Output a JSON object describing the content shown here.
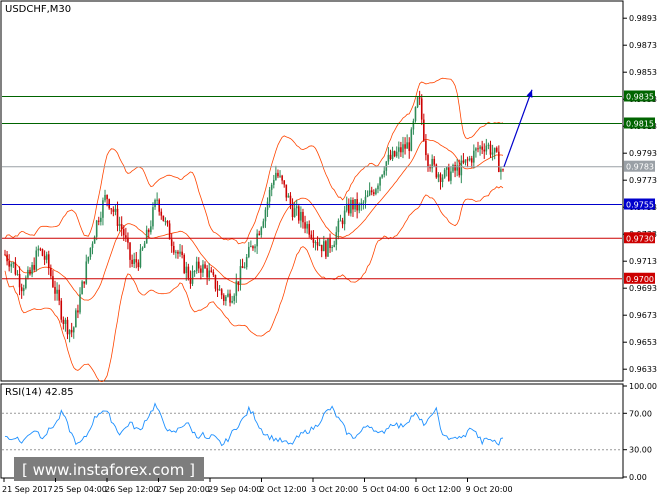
{
  "chart_data": [
    {
      "type": "candlestick",
      "title": "USDCHF,M30",
      "y_ticks": [
        "0.9893",
        "0.9873",
        "0.9853",
        "0.9833",
        "0.9813",
        "0.9793",
        "0.9773",
        "0.9753",
        "0.9733",
        "0.9713",
        "0.9693",
        "0.9673",
        "0.9653",
        "0.9633"
      ],
      "ylim": [
        0.9625,
        0.9905
      ],
      "x_ticks": [
        "21 Sep 2017",
        "25 Sep 04:00",
        "26 Sep 12:00",
        "27 Sep 20:00",
        "29 Sep 04:00",
        "2 Oct 12:00",
        "3 Oct 20:00",
        "5 Oct 04:00",
        "6 Oct 12:00",
        "9 Oct 20:00"
      ],
      "current_price": "0.9783",
      "price_path": [
        [
          0,
          0.9718
        ],
        [
          2,
          0.971
        ],
        [
          4,
          0.9695
        ],
        [
          6,
          0.9703
        ],
        [
          8,
          0.9722
        ],
        [
          10,
          0.9712
        ],
        [
          12,
          0.969
        ],
        [
          14,
          0.9668
        ],
        [
          16,
          0.966
        ],
        [
          18,
          0.969
        ],
        [
          20,
          0.972
        ],
        [
          22,
          0.9745
        ],
        [
          24,
          0.9762
        ],
        [
          26,
          0.9748
        ],
        [
          28,
          0.9735
        ],
        [
          30,
          0.971
        ],
        [
          32,
          0.9715
        ],
        [
          34,
          0.9735
        ],
        [
          36,
          0.976
        ],
        [
          38,
          0.974
        ],
        [
          40,
          0.9725
        ],
        [
          42,
          0.9712
        ],
        [
          44,
          0.97
        ],
        [
          46,
          0.971
        ],
        [
          48,
          0.9705
        ],
        [
          50,
          0.9695
        ],
        [
          52,
          0.9685
        ],
        [
          54,
          0.969
        ],
        [
          56,
          0.9705
        ],
        [
          58,
          0.972
        ],
        [
          60,
          0.9735
        ],
        [
          62,
          0.9755
        ],
        [
          64,
          0.978
        ],
        [
          66,
          0.9768
        ],
        [
          68,
          0.9752
        ],
        [
          70,
          0.9745
        ],
        [
          72,
          0.9738
        ],
        [
          74,
          0.9728
        ],
        [
          76,
          0.9722
        ],
        [
          78,
          0.973
        ],
        [
          80,
          0.9745
        ],
        [
          82,
          0.9755
        ],
        [
          84,
          0.9752
        ],
        [
          86,
          0.976
        ],
        [
          88,
          0.977
        ],
        [
          90,
          0.9786
        ],
        [
          92,
          0.979
        ],
        [
          94,
          0.9796
        ],
        [
          96,
          0.98
        ],
        [
          98,
          0.9835
        ],
        [
          100,
          0.979
        ],
        [
          102,
          0.978
        ],
        [
          104,
          0.9776
        ],
        [
          106,
          0.9779
        ],
        [
          108,
          0.9782
        ],
        [
          110,
          0.9788
        ],
        [
          112,
          0.9796
        ],
        [
          114,
          0.98
        ],
        [
          116,
          0.9792
        ],
        [
          118,
          0.9778
        ]
      ],
      "price_lines": [
        {
          "label": "0.9835",
          "value": 0.9835,
          "color": "#006400"
        },
        {
          "label": "0.9815",
          "value": 0.9815,
          "color": "#006400"
        },
        {
          "label": "0.9783",
          "value": 0.9783,
          "color": "#9aa0a6"
        },
        {
          "label": "0.9755",
          "value": 0.9755,
          "color": "#0000cc"
        },
        {
          "label": "0.9730",
          "value": 0.973,
          "color": "#cc0000"
        },
        {
          "label": "0.9700",
          "value": 0.97,
          "color": "#cc0000"
        }
      ],
      "forecast_arrow": {
        "from_price": 0.9783,
        "to_price": 0.984,
        "color": "#0000cc"
      },
      "colors": {
        "bull": "#2e8b57",
        "bear": "#cc0000",
        "bands": "#ff4500",
        "axis": "#000000"
      },
      "grid": false
    },
    {
      "type": "line",
      "title": "RSI(14) 42.85",
      "y_ticks": [
        "100.00",
        "70.00",
        "30.00",
        "0.00"
      ],
      "ylim": [
        0,
        100
      ],
      "levels": [
        70,
        30
      ],
      "series": [
        {
          "values": [
            46,
            40,
            45,
            38,
            42,
            50,
            52,
            44,
            48,
            55,
            60,
            72,
            58,
            45,
            35,
            40,
            48,
            62,
            70,
            74,
            68,
            58,
            48,
            52,
            60,
            55,
            50,
            62,
            70,
            80,
            66,
            56,
            47,
            50,
            56,
            60,
            52,
            44,
            48,
            40,
            45,
            40,
            35,
            42,
            50,
            58,
            64,
            74,
            68,
            56,
            48,
            44,
            42,
            40,
            38,
            35,
            41,
            46,
            50,
            52,
            56,
            64,
            72,
            76,
            66,
            58,
            48,
            44,
            46,
            52,
            58,
            54,
            46,
            50,
            56,
            60,
            55,
            58,
            64,
            70,
            62,
            58,
            64,
            78,
            50,
            46,
            40,
            44,
            42,
            48,
            55,
            46,
            38,
            42,
            40,
            36,
            42.85
          ]
        }
      ],
      "colors": {
        "line": "#1e90ff",
        "levels": "#999999"
      }
    }
  ],
  "watermark": "[ www.instaforex.com ]"
}
